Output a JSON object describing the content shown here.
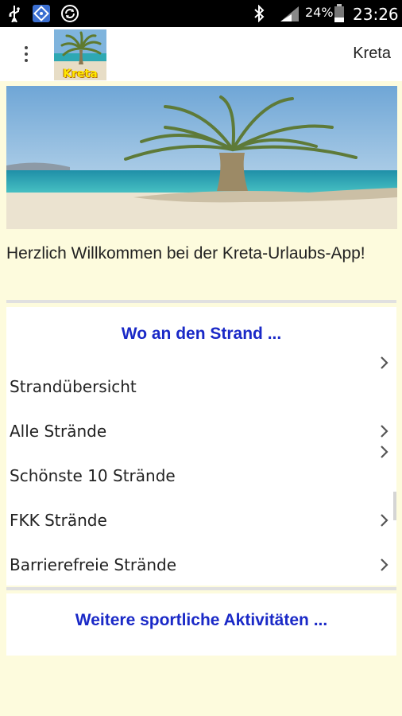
{
  "status_bar": {
    "battery_percent": "24%",
    "time": "23:26",
    "icons": [
      "usb-icon",
      "app-icon",
      "sync-icon",
      "bluetooth-icon",
      "signal-icon",
      "battery-icon"
    ]
  },
  "app_bar": {
    "logo_text": "Kreta",
    "title": "Kreta"
  },
  "welcome_text": "Herzlich Willkommen bei der Kreta-Urlaubs-App!",
  "beach_section": {
    "header": "Wo an den Strand ...",
    "items": [
      {
        "label": "Strandübersicht"
      },
      {
        "label": "Alle Strände"
      },
      {
        "label": "Schönste 10 Strände"
      },
      {
        "label": "FKK Strände"
      },
      {
        "label": "Barrierefreie Strände"
      }
    ]
  },
  "sports_section": {
    "header": "Weitere sportliche Aktivitäten ..."
  },
  "colors": {
    "background": "#fdfbdd",
    "accent": "#1a29c7",
    "status_bar": "#000000"
  }
}
